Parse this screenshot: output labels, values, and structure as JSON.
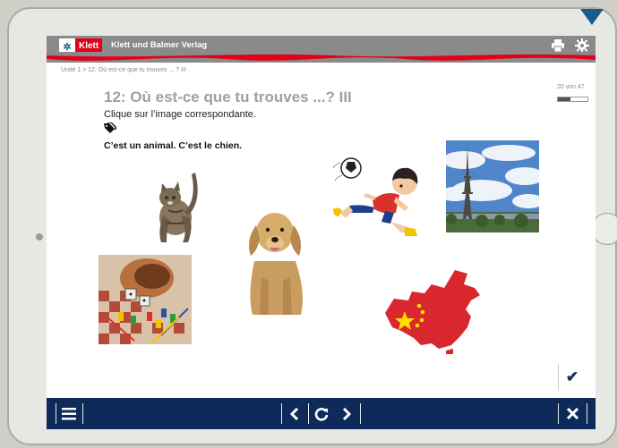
{
  "header": {
    "logo_text": "Klett",
    "publisher": "Klett und Balmer Verlag",
    "print_icon": "print-icon",
    "settings_icon": "gear-icon"
  },
  "breadcrumb": "Unité 1 > 12: Où est-ce que tu trouves ... ? III",
  "exercise": {
    "title": "12: Où est-ce que tu trouves ...? III",
    "instruction": "Clique sur l’image correspondante.",
    "prompt": "C’est un animal. C’est le chien.",
    "progress_text": "20 von 47",
    "progress": 0.43
  },
  "choices": [
    {
      "name": "cat-image"
    },
    {
      "name": "board-game-image"
    },
    {
      "name": "dog-image"
    },
    {
      "name": "football-boy-image"
    },
    {
      "name": "eiffel-tower-image"
    },
    {
      "name": "china-map-image"
    }
  ],
  "footer": {
    "menu_icon": "menu-icon",
    "prev_icon": "chevron-left-icon",
    "reload_icon": "reload-icon",
    "next_icon": "chevron-right-icon",
    "close_icon": "close-icon",
    "check_icon": "checkmark-icon"
  },
  "colors": {
    "header_grey": "#8a8a8a",
    "brand_red": "#e2001a",
    "footer_navy": "#0e2a5b"
  }
}
